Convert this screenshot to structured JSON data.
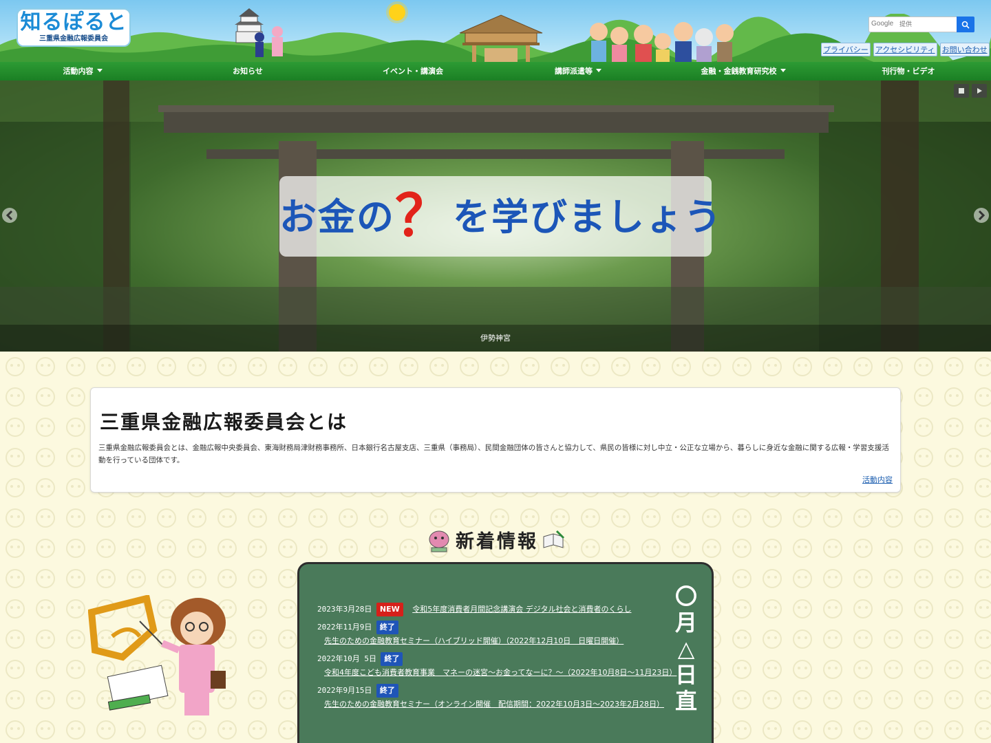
{
  "header": {
    "logo_title": "知るぽると",
    "logo_subtitle": "三重県金融広報委員会",
    "search_label": "Google",
    "search_placeholder": "提供",
    "util_links": [
      "プライバシー",
      "アクセシビリティ",
      "お問い合わせ"
    ]
  },
  "nav": {
    "items": [
      {
        "label": "活動内容",
        "dropdown": true
      },
      {
        "label": "お知らせ",
        "dropdown": false
      },
      {
        "label": "イベント・講演会",
        "dropdown": false
      },
      {
        "label": "講師派遣等",
        "dropdown": true
      },
      {
        "label": "金融・金銭教育研究校",
        "dropdown": true
      },
      {
        "label": "刊行物・ビデオ",
        "dropdown": false
      }
    ]
  },
  "hero": {
    "banner_pre": "お金の",
    "banner_q": "？",
    "banner_post": "を学びましょう",
    "caption": "伊勢神宮",
    "controls": [
      "stop-icon",
      "play-icon"
    ]
  },
  "about": {
    "title": "三重県金融広報委員会とは",
    "body": "三重県金融広報委員会とは、金融広報中央委員会、東海財務局津財務事務所、日本銀行名古屋支店、三重県（事務局）、民間金融団体の皆さんと協力して、県民の皆様に対し中立・公正な立場から、暮らしに身近な金融に関する広報・学習支援活動を行っている団体です。",
    "link": "活動内容"
  },
  "news": {
    "title": "新着情報",
    "board_side": [
      "〇",
      "月",
      "△",
      "日",
      "直"
    ],
    "items": [
      {
        "date": "2023年3月28日",
        "badge": "NEW",
        "badge_type": "new",
        "title": "令和5年度消費者月間記念講演会 デジタル社会と消費者のくらし"
      },
      {
        "date": "2022年11月9日",
        "badge": "終了",
        "badge_type": "end",
        "title": "先生のための金融教育セミナー（ハイブリッド開催）（2022年12月10日　日曜日開催）"
      },
      {
        "date": "2022年10月 5日",
        "badge": "終了",
        "badge_type": "end",
        "title": "令和4年度こども消費者教育事業　マネーの迷宮～お金ってなーに？～（2022年10月8日～11月23日）"
      },
      {
        "date": "2022年9月15日",
        "badge": "終了",
        "badge_type": "end",
        "title": "先生のための金融教育セミナー（オンライン開催　配信期間：2022年10月3日～2023年2月28日）"
      }
    ]
  }
}
